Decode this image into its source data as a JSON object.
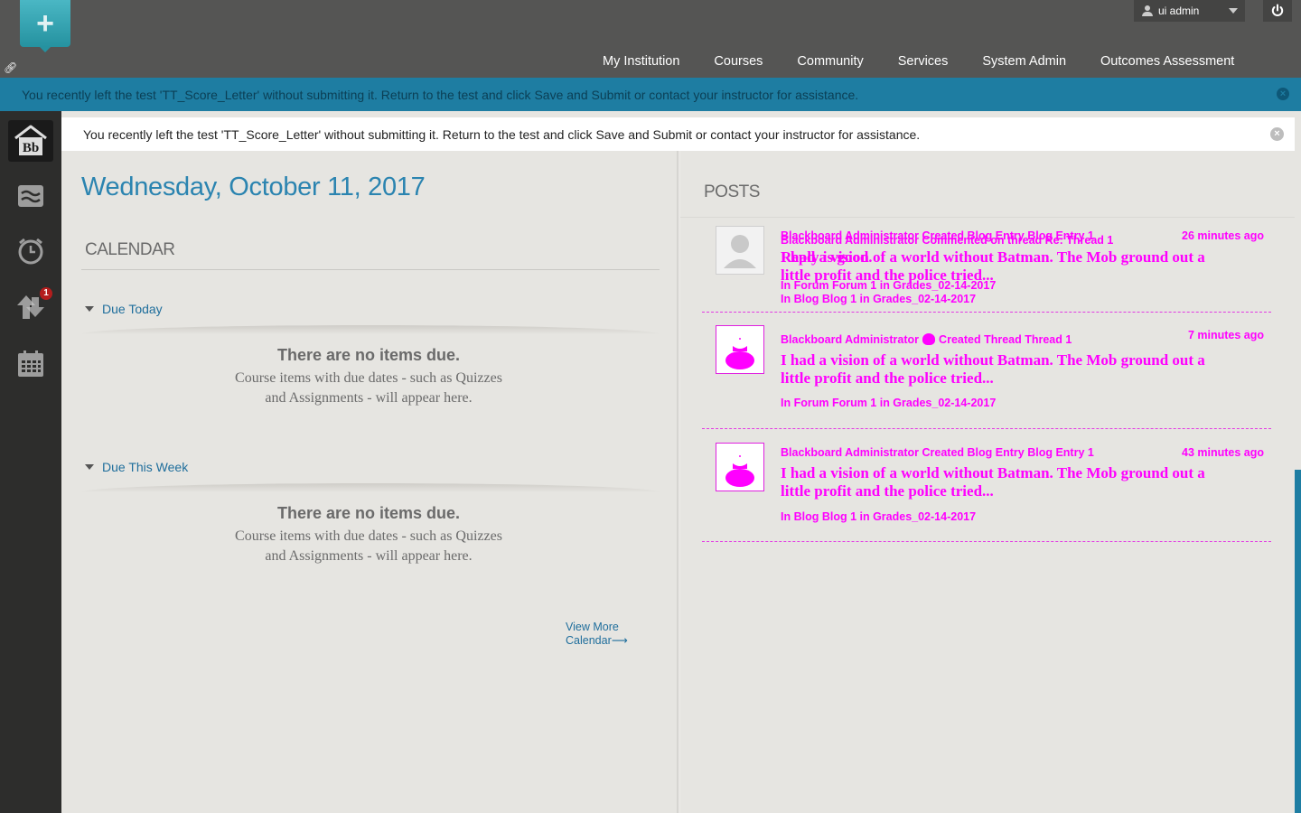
{
  "header": {
    "user_name": "ui admin",
    "nav": [
      "My Institution",
      "Courses",
      "Community",
      "Services",
      "System Admin",
      "Outcomes Assessment"
    ]
  },
  "alerts": {
    "global": "You recently left the test 'TT_Score_Letter' without submitting it. Return to the test and click Save and Submit or contact your instructor for assistance.",
    "inline": "You recently left the test 'TT_Score_Letter' without submitting it. Return to the test and click Save and Submit or contact your instructor for assistance."
  },
  "rail": {
    "home_label": "Bb",
    "badge_count": "1",
    "items": [
      "stream-icon",
      "alarm-clock-icon",
      "grades-arrow-icon",
      "calendar-icon"
    ]
  },
  "calendar": {
    "date": "Wednesday, October 11, 2017",
    "title": "CALENDAR",
    "sections": [
      {
        "label": "Due Today",
        "empty_title": "There are no items due.",
        "empty_text": "Course items with due dates - such as Quizzes and Assignments - will appear here."
      },
      {
        "label": "Due This Week",
        "empty_title": "There are no items due.",
        "empty_text": "Course items with due dates - such as Quizzes and Assignments - will appear here."
      }
    ],
    "view_more": "View More Calendar⟶"
  },
  "posts": {
    "title": "POSTS",
    "items": [
      {
        "meta": "Blackboard Administrator Created Blog Entry Blog Entry 1",
        "meta_overlap": "Blackboard Administrator Commented on thread Re: Thread 1",
        "time": "26 minutes ago",
        "reply": "Reply is good.",
        "body": "I had a vision of a world without Batman. The Mob ground out a little profit and the police tried...",
        "loc1": "In Forum Forum 1 in Grades_02-14-2017",
        "loc2": "In Blog Blog 1 in Grades_02-14-2017"
      },
      {
        "author": "Blackboard Administrator",
        "action": "Created Thread Thread 1",
        "time": "7 minutes ago",
        "body": "I had a vision of a world without Batman. The Mob ground out a little profit and the police tried...",
        "loc": "In Forum Forum 1 in Grades_02-14-2017"
      },
      {
        "meta": "Blackboard Administrator Created Blog Entry Blog Entry 1",
        "time": "43 minutes ago",
        "body": "I had a vision of a world without Batman. The Mob ground out a little profit and the police tried...",
        "loc": "In Blog Blog 1 in Grades_02-14-2017"
      }
    ]
  }
}
